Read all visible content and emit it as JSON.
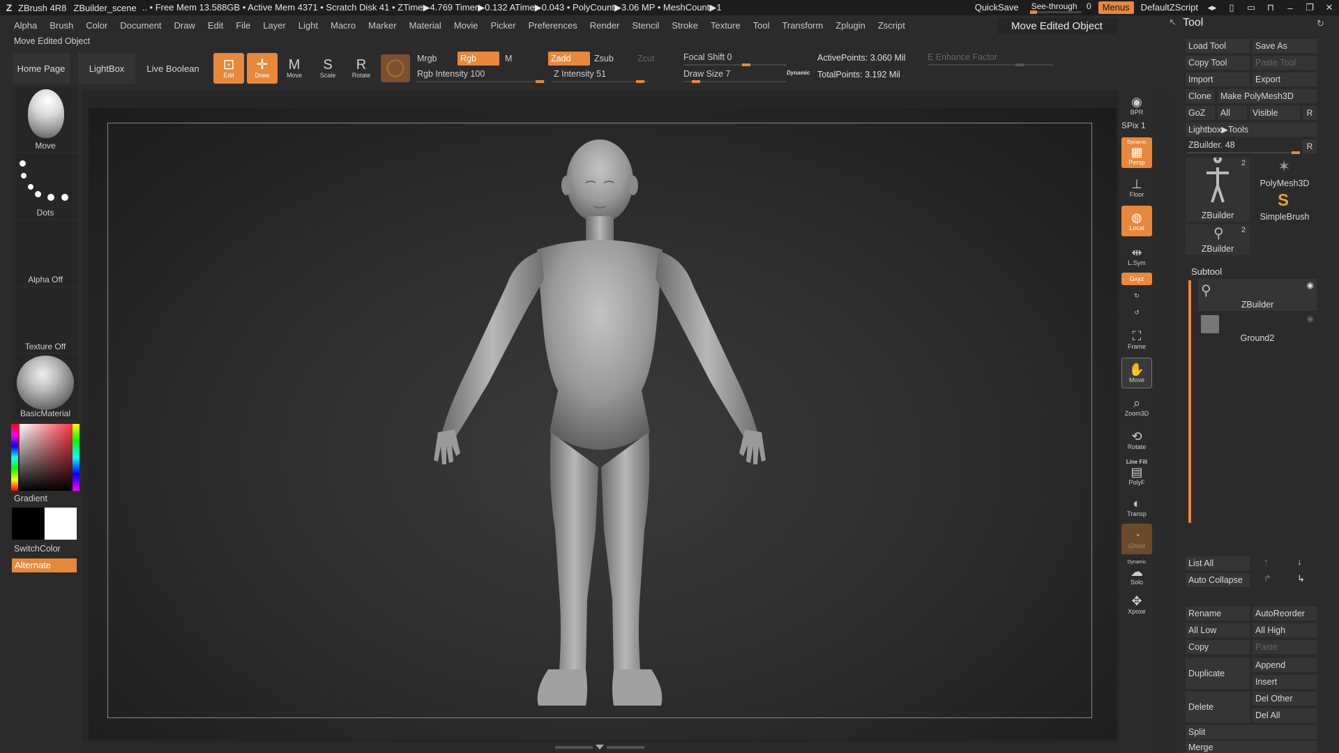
{
  "titlebar": {
    "app": "ZBrush 4R8",
    "document": "ZBuilder_scene",
    "stats": ".. • Free Mem 13.588GB • Active Mem 4371 • Scratch Disk 41 • ZTime▶4.769 Timer▶0.132 ATime▶0.043 • PolyCount▶3.06 MP • MeshCount▶1",
    "quicksave": "QuickSave",
    "see_through_label": "See-through",
    "see_through_value": "0",
    "menus": "Menus",
    "zscript": "DefaultZScript"
  },
  "menubar": [
    "Alpha",
    "Brush",
    "Color",
    "Document",
    "Draw",
    "Edit",
    "File",
    "Layer",
    "Light",
    "Macro",
    "Marker",
    "Material",
    "Movie",
    "Picker",
    "Preferences",
    "Render",
    "Stencil",
    "Stroke",
    "Texture",
    "Tool",
    "Transform",
    "Zplugin",
    "Zscript"
  ],
  "tooltip": "Move Edited Object",
  "toolbar": {
    "sub_label": "Move Edited Object",
    "home_page": "Home Page",
    "lightbox": "LightBox",
    "live_boolean": "Live Boolean",
    "edit": "Edit",
    "draw": "Draw",
    "move": "Move",
    "scale": "Scale",
    "rotate": "Rotate",
    "mrgb": "Mrgb",
    "rgb": "Rgb",
    "m": "M",
    "zadd": "Zadd",
    "zsub": "Zsub",
    "zcut": "Zcut",
    "rgb_intensity": "Rgb Intensity 100",
    "z_intensity": "Z Intensity 51",
    "focal_shift": "Focal Shift 0",
    "draw_size": "Draw Size 7",
    "dynamic": "Dynamic",
    "active_points": "ActivePoints: 3.060 Mil",
    "total_points": "TotalPoints: 3.192 Mil",
    "enhance_factor": "E Enhance Factor"
  },
  "leftpanel": {
    "brush": "Move",
    "stroke": "Dots",
    "alpha": "Alpha Off",
    "texture": "Texture Off",
    "material": "BasicMaterial",
    "gradient": "Gradient",
    "switchcolor": "SwitchColor",
    "alternate": "Alternate"
  },
  "rshelf": {
    "bpr": "BPR",
    "spix": "SPix 1",
    "dynamic": "Dynamic",
    "persp": "Persp",
    "floor": "Floor",
    "local": "Local",
    "lsym": "L.Sym",
    "xyz": "Gxyz",
    "frame": "Frame",
    "move": "Move",
    "zoom3d": "Zoom3D",
    "rotate": "Rotate",
    "line_fill": "Line Fill",
    "polyf": "PolyF",
    "transp": "Transp",
    "ghost": "Ghost",
    "solo": "Solo",
    "xpose": "Xpose"
  },
  "toolpanel": {
    "title": "Tool",
    "load_tool": "Load Tool",
    "save_as": "Save As",
    "copy_tool": "Copy Tool",
    "paste_tool": "Paste Tool",
    "import": "Import",
    "export": "Export",
    "clone": "Clone",
    "make_polymesh": "Make PolyMesh3D",
    "goz": "GoZ",
    "all": "All",
    "visible": "Visible",
    "r": "R",
    "lightbox_tools": "Lightbox▶Tools",
    "zbuilder_slider": "ZBuilder. 48",
    "thumb1_label": "ZBuilder",
    "thumb1_count": "2",
    "thumb2_label": "PolyMesh3D",
    "thumb3_label": "SimpleBrush",
    "thumb4_label": "ZBuilder",
    "thumb4_count": "2",
    "subtool_title": "Subtool",
    "subtools": [
      "ZBuilder",
      "Ground2"
    ],
    "list_all": "List All",
    "auto_collapse": "Auto Collapse",
    "rename": "Rename",
    "autoreorder": "AutoReorder",
    "all_low": "All Low",
    "all_high": "All High",
    "copy": "Copy",
    "paste": "Paste",
    "duplicate": "Duplicate",
    "append": "Append",
    "insert": "Insert",
    "delete": "Delete",
    "del_other": "Del Other",
    "del_all": "Del All",
    "split": "Split",
    "merge": "Merge"
  },
  "colors": {
    "accent": "#e8883a",
    "background": "#2b2b2b",
    "canvas": "#303030"
  }
}
